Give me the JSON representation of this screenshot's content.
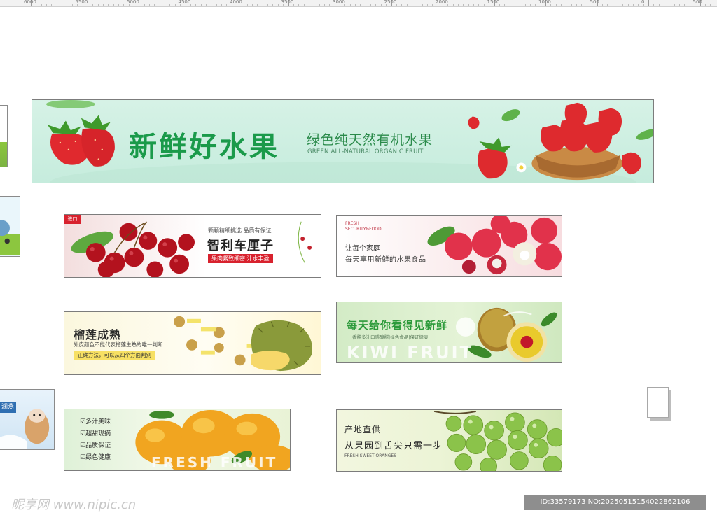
{
  "ruler": {
    "labels": [
      "6000",
      "5500",
      "5000",
      "4500",
      "4000",
      "3500",
      "3000",
      "2500",
      "2000",
      "1500",
      "1000",
      "500",
      "0",
      "500"
    ]
  },
  "banners": {
    "main": {
      "title": "新鲜好水果",
      "subtitle": "绿色纯天然有机水果",
      "subtitle_en": "GREEN ALL-NATURAL ORGANIC FRUIT"
    },
    "cherry": {
      "tag": "进口",
      "small": "颗颗精细挑选 品质有保证",
      "title": "智利车厘子",
      "badge": "果肉紧致细密 汁水丰盈"
    },
    "lychee": {
      "en": "FRESH\nSECURITY&FOOD",
      "line1": "让每个家庭",
      "line2": "每天享用新鲜的水果食品"
    },
    "durian": {
      "title": "榴莲成熟",
      "subtitle": "外皮颜色不能代表榴莲生熟的唯一判断",
      "note": "正确方法，可以从四个方面判别"
    },
    "kiwi": {
      "title": "每天给你看得见新鲜",
      "subtitle": "香甜多汁口感酸甜|绿色食品|保证健康",
      "big": "KIWI FRUIT"
    },
    "mango": {
      "items": [
        "☑多汁美味",
        "☑超甜现摘",
        "☑品质保证",
        "☑绿色健康"
      ],
      "big": "FRESH FRUIT"
    },
    "grape": {
      "line1": "产地直供",
      "line2": "从果园到舌尖只需一步",
      "en": "FRESH SWEET ORANGES"
    }
  },
  "edges": {
    "third_label": "润燕"
  },
  "watermark": "昵享网 www.nipic.cn",
  "id_bar": "ID:33579173 NO:20250515154022862106",
  "colors": {
    "brand_green": "#1a9a4a",
    "accent_red": "#d8222e",
    "kiwi_green": "#2c9a3a"
  }
}
